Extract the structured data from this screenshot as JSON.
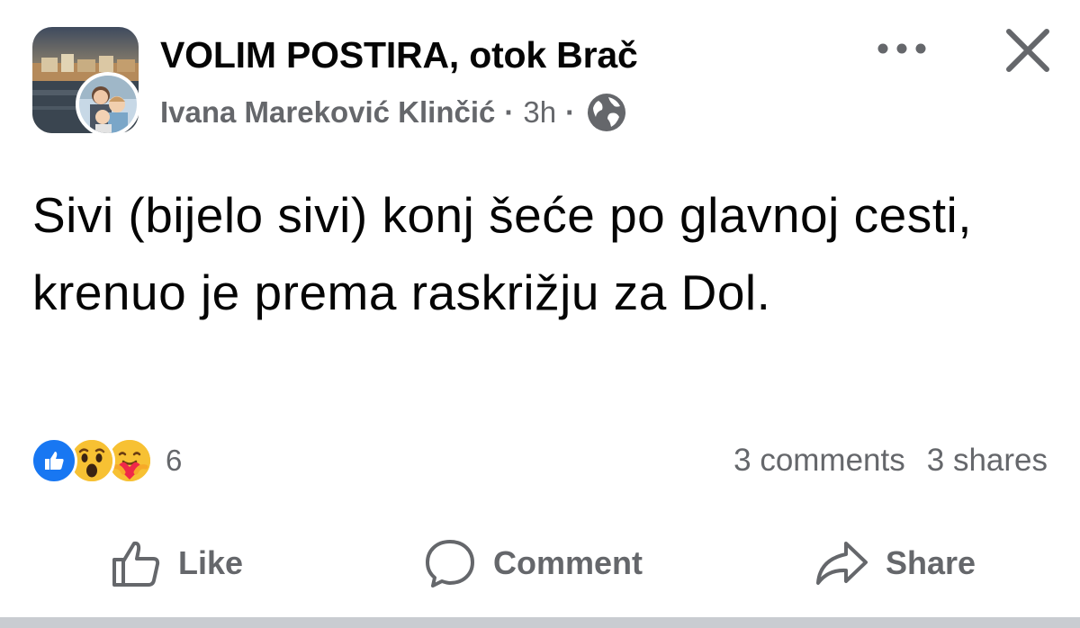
{
  "header": {
    "group_name": "VOLIM POSTIRA, otok Brač",
    "author": "Ivana Mareković Klinčić",
    "separator": "·",
    "timestamp": "3h",
    "privacy_icon": "globe-icon",
    "more_icon": "more-horizontal-icon",
    "close_icon": "close-icon"
  },
  "post": {
    "text": "Sivi (bijelo sivi) konj šeće po glavnoj cesti, krenuo je prema raskrižju za Dol."
  },
  "stats": {
    "reactions": [
      "like-reaction-icon",
      "wow-reaction-icon",
      "care-reaction-icon"
    ],
    "reaction_count": "6",
    "comments": "3 comments",
    "shares": "3 shares"
  },
  "actions": {
    "like_label": "Like",
    "comment_label": "Comment",
    "share_label": "Share"
  },
  "colors": {
    "primary_text": "#050505",
    "secondary_text": "#65676b",
    "like_blue": "#1877f2",
    "wow_yellow": "#f7b928",
    "divider": "#c9ccd1"
  }
}
